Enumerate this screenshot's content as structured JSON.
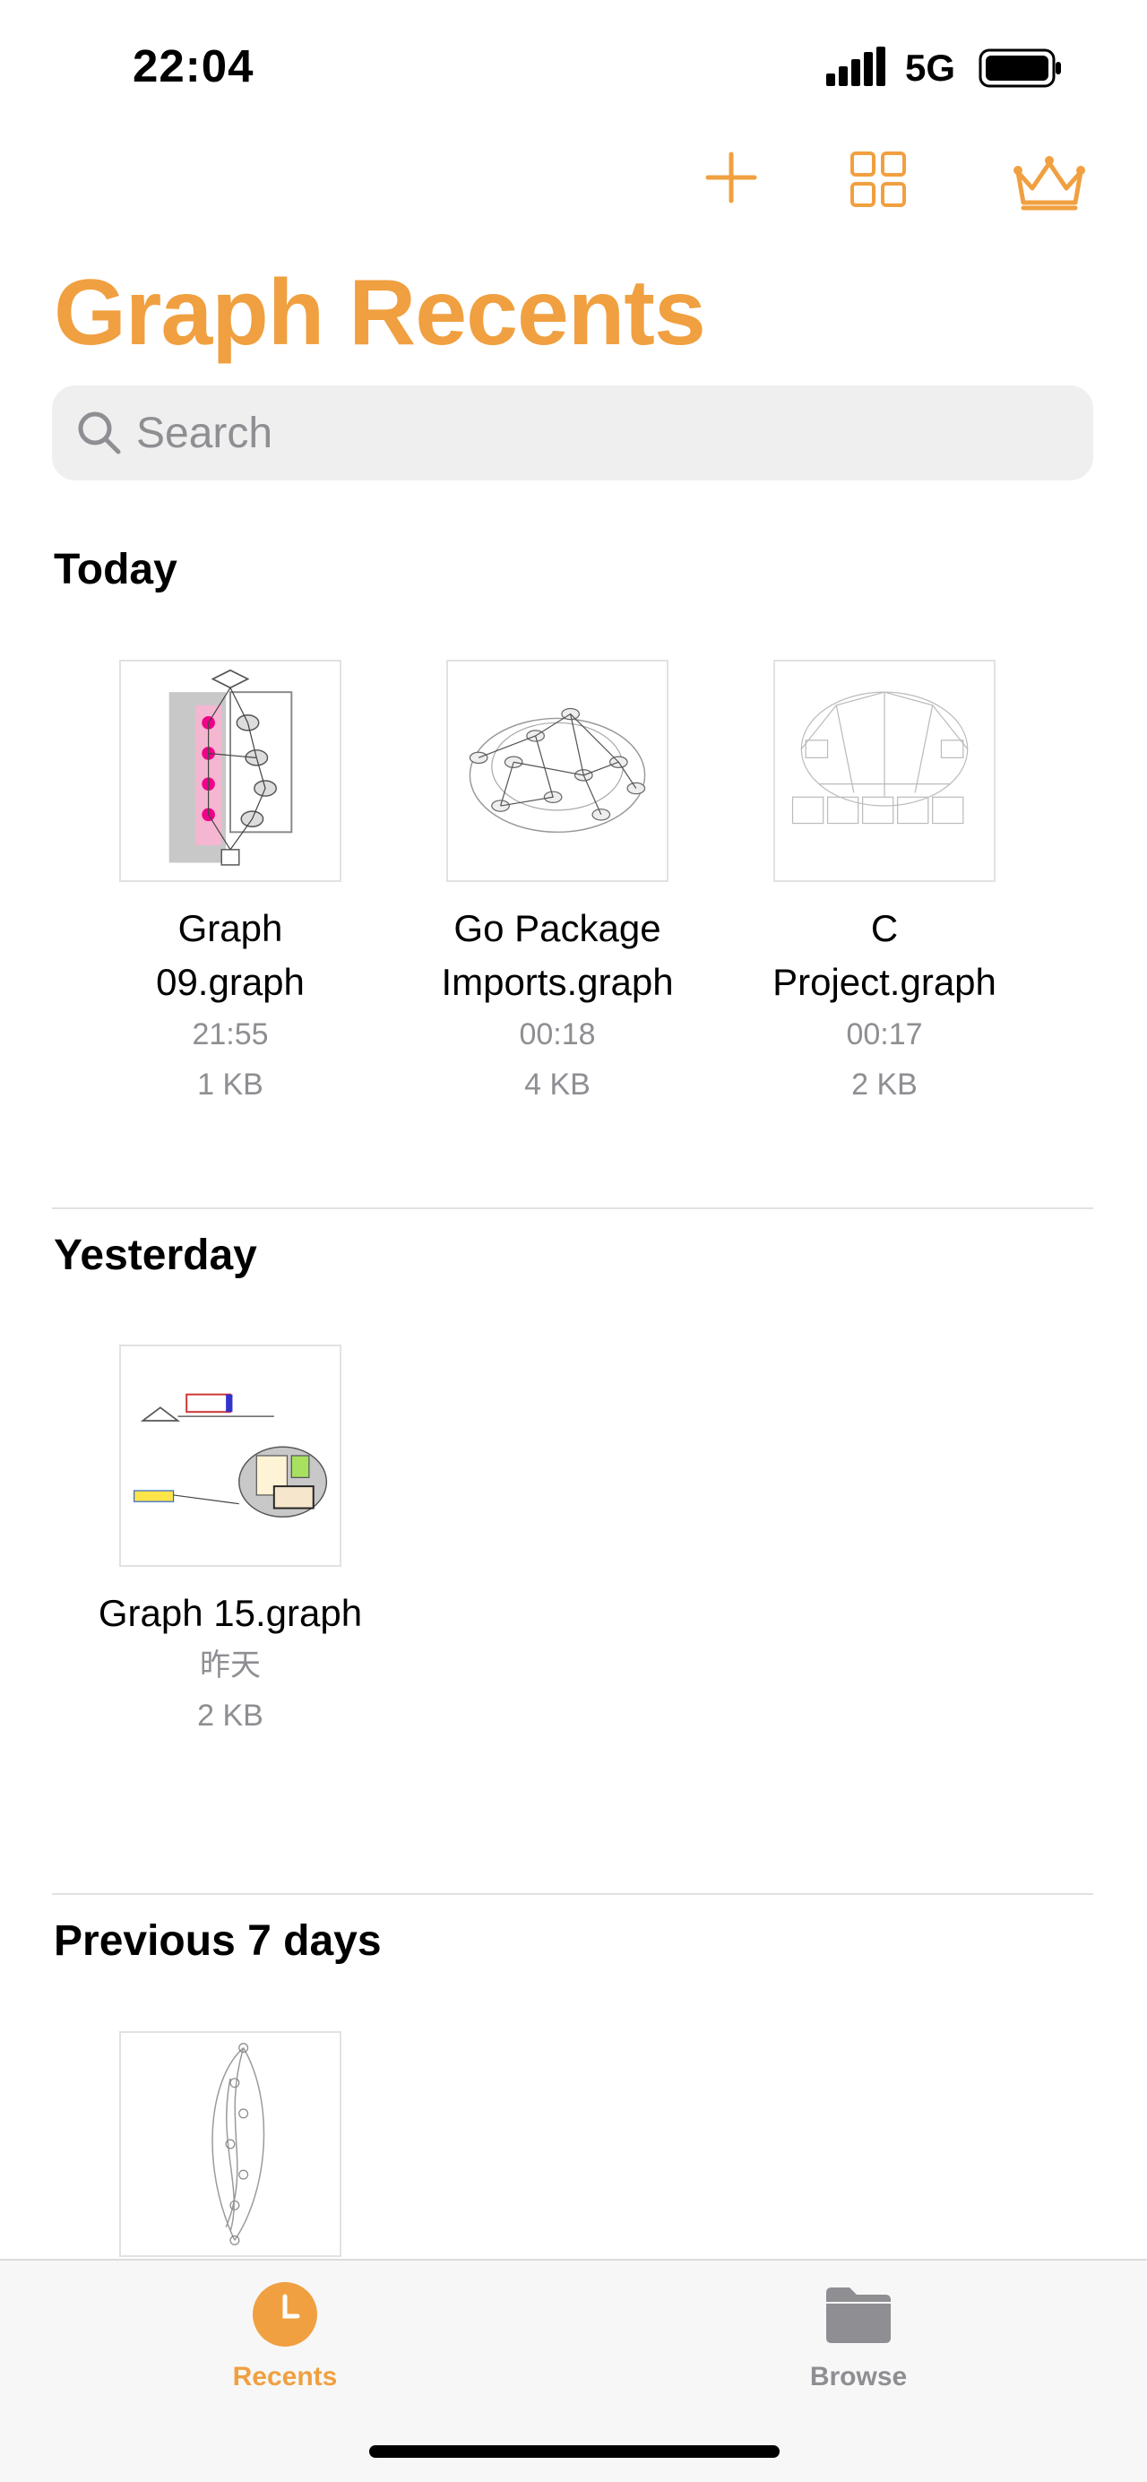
{
  "status_bar": {
    "time": "22:04",
    "network": "5G"
  },
  "title": "Graph Recents",
  "search": {
    "placeholder": "Search"
  },
  "colors": {
    "accent": "#f0a040",
    "secondary_text": "#8e8e93",
    "search_bg": "#efefef"
  },
  "sections": [
    {
      "title": "Today",
      "items": [
        {
          "name": "Graph\n09.graph",
          "time": "21:55",
          "size": "1 KB"
        },
        {
          "name": "Go Package\nImports.graph",
          "time": "00:18",
          "size": "4 KB"
        },
        {
          "name": "C\nProject.graph",
          "time": "00:17",
          "size": "2 KB"
        }
      ]
    },
    {
      "title": "Yesterday",
      "items": [
        {
          "name": "Graph 15.graph",
          "time": "昨天",
          "size": "2 KB"
        }
      ]
    },
    {
      "title": "Previous 7 days",
      "items": [
        {}
      ]
    }
  ],
  "tabbar": {
    "tabs": [
      {
        "label": "Recents",
        "icon": "clock-icon",
        "active": true
      },
      {
        "label": "Browse",
        "icon": "folder-icon",
        "active": false
      }
    ]
  }
}
